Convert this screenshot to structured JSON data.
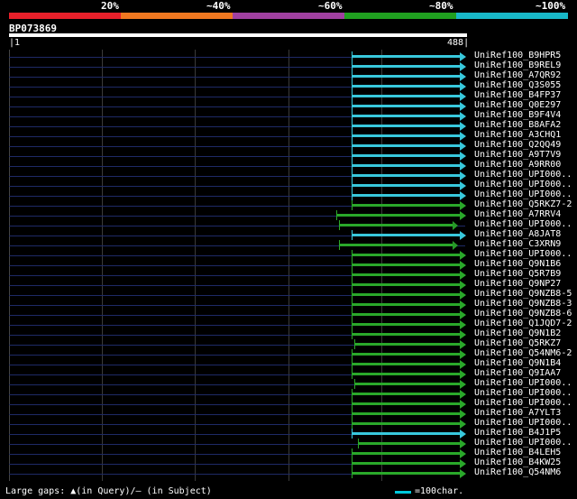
{
  "identity_scale": {
    "labels": [
      "20%",
      "~40%",
      "~60%",
      "~80%",
      "~100%"
    ],
    "colors": [
      "#e8202a",
      "#f07820",
      "#a040a0",
      "#20a020",
      "#18b8c8"
    ]
  },
  "query": {
    "name": "BP073869",
    "start": "1",
    "end": "488",
    "length": 488
  },
  "colors": {
    "cyan": "#38c8dc",
    "green": "#2aa82a",
    "baseline": "#1e2a66"
  },
  "hits": [
    {
      "label": "UniRef100_B9HPR5",
      "start": 367,
      "end": 488,
      "color": "cyan",
      "cont": true
    },
    {
      "label": "UniRef100_B9REL9",
      "start": 367,
      "end": 488,
      "color": "cyan",
      "cont": true
    },
    {
      "label": "UniRef100_A7QR92",
      "start": 367,
      "end": 488,
      "color": "cyan",
      "cont": true
    },
    {
      "label": "UniRef100_Q3S055",
      "start": 367,
      "end": 488,
      "color": "cyan",
      "cont": true
    },
    {
      "label": "UniRef100_B4FP37",
      "start": 367,
      "end": 488,
      "color": "cyan",
      "cont": true
    },
    {
      "label": "UniRef100_Q0E297",
      "start": 367,
      "end": 488,
      "color": "cyan",
      "cont": true
    },
    {
      "label": "UniRef100_B9F4V4",
      "start": 367,
      "end": 488,
      "color": "cyan",
      "cont": true
    },
    {
      "label": "UniRef100_B8AFA2",
      "start": 367,
      "end": 488,
      "color": "cyan",
      "cont": true
    },
    {
      "label": "UniRef100_A3CHQ1",
      "start": 367,
      "end": 488,
      "color": "cyan",
      "cont": true
    },
    {
      "label": "UniRef100_Q2QQ49",
      "start": 367,
      "end": 488,
      "color": "cyan",
      "cont": true
    },
    {
      "label": "UniRef100_A9T7V9",
      "start": 367,
      "end": 488,
      "color": "cyan",
      "cont": true
    },
    {
      "label": "UniRef100_A9RR00",
      "start": 367,
      "end": 488,
      "color": "cyan",
      "cont": true
    },
    {
      "label": "UniRef100_UPI000..",
      "start": 367,
      "end": 488,
      "color": "cyan",
      "cont": true
    },
    {
      "label": "UniRef100_UPI000..",
      "start": 367,
      "end": 488,
      "color": "cyan",
      "cont": true
    },
    {
      "label": "UniRef100_UPI000..",
      "start": 367,
      "end": 488,
      "color": "cyan",
      "cont": true
    },
    {
      "label": "UniRef100_Q5RKZ7-2",
      "start": 367,
      "end": 488,
      "color": "green",
      "cont": true
    },
    {
      "label": "UniRef100_A7RRV4",
      "start": 350,
      "end": 488,
      "color": "green",
      "cont": true
    },
    {
      "label": "UniRef100_UPI000..",
      "start": 353,
      "end": 480,
      "color": "green",
      "cont": false
    },
    {
      "label": "UniRef100_A8JAT8",
      "start": 367,
      "end": 488,
      "color": "cyan",
      "cont": true
    },
    {
      "label": "UniRef100_C3XRN9",
      "start": 353,
      "end": 480,
      "color": "green",
      "cont": false
    },
    {
      "label": "UniRef100_UPI000..",
      "start": 367,
      "end": 488,
      "color": "green",
      "cont": true
    },
    {
      "label": "UniRef100_Q9N1B6",
      "start": 367,
      "end": 488,
      "color": "green",
      "cont": true
    },
    {
      "label": "UniRef100_Q5R7B9",
      "start": 367,
      "end": 488,
      "color": "green",
      "cont": true
    },
    {
      "label": "UniRef100_Q9NP27",
      "start": 367,
      "end": 488,
      "color": "green",
      "cont": true
    },
    {
      "label": "UniRef100_Q9NZB8-5",
      "start": 367,
      "end": 488,
      "color": "green",
      "cont": true
    },
    {
      "label": "UniRef100_Q9NZB8-3",
      "start": 367,
      "end": 488,
      "color": "green",
      "cont": true
    },
    {
      "label": "UniRef100_Q9NZB8-6",
      "start": 367,
      "end": 488,
      "color": "green",
      "cont": true
    },
    {
      "label": "UniRef100_Q1JQD7-2",
      "start": 367,
      "end": 488,
      "color": "green",
      "cont": true
    },
    {
      "label": "UniRef100_Q9N1B2",
      "start": 367,
      "end": 488,
      "color": "green",
      "cont": true
    },
    {
      "label": "UniRef100_Q5RKZ7",
      "start": 370,
      "end": 488,
      "color": "green",
      "cont": true
    },
    {
      "label": "UniRef100_Q54NM6-2",
      "start": 367,
      "end": 488,
      "color": "green",
      "cont": true
    },
    {
      "label": "UniRef100_Q9N1B4",
      "start": 367,
      "end": 488,
      "color": "green",
      "cont": true
    },
    {
      "label": "UniRef100_Q9IAA7",
      "start": 367,
      "end": 488,
      "color": "green",
      "cont": true
    },
    {
      "label": "UniRef100_UPI000..",
      "start": 370,
      "end": 488,
      "color": "green",
      "cont": true
    },
    {
      "label": "UniRef100_UPI000..",
      "start": 367,
      "end": 488,
      "color": "green",
      "cont": true
    },
    {
      "label": "UniRef100_UPI000..",
      "start": 367,
      "end": 488,
      "color": "green",
      "cont": true
    },
    {
      "label": "UniRef100_A7YLT3",
      "start": 367,
      "end": 488,
      "color": "green",
      "cont": true
    },
    {
      "label": "UniRef100_UPI000..",
      "start": 367,
      "end": 488,
      "color": "green",
      "cont": true
    },
    {
      "label": "UniRef100_B4J1P5",
      "start": 367,
      "end": 488,
      "color": "cyan",
      "cont": true
    },
    {
      "label": "UniRef100_UPI000..",
      "start": 373,
      "end": 488,
      "color": "green",
      "cont": true
    },
    {
      "label": "UniRef100_B4LEH5",
      "start": 367,
      "end": 488,
      "color": "green",
      "cont": true
    },
    {
      "label": "UniRef100_B4KW25",
      "start": 367,
      "end": 488,
      "color": "green",
      "cont": true
    },
    {
      "label": "UniRef100_Q54NM6",
      "start": 367,
      "end": 488,
      "color": "green",
      "cont": true
    }
  ],
  "footer": {
    "gaps_text": "Large gaps: ▲(in Query)/– (in Subject)",
    "legend_text": "=100char."
  }
}
